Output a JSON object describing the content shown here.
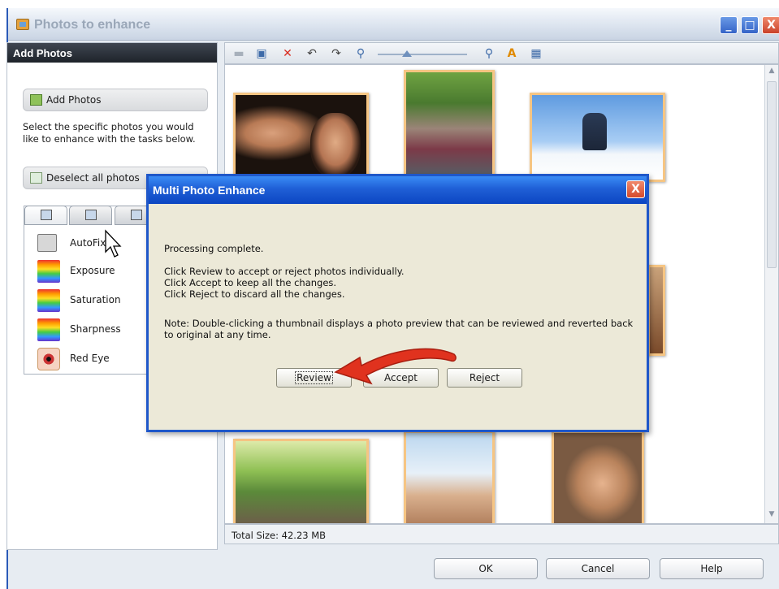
{
  "window": {
    "title": "Photos to enhance",
    "controls": {
      "minimize": "_",
      "maximize": "□",
      "close": "X"
    }
  },
  "left_panel": {
    "header": "Add Photos",
    "add_photos_button": "Add Photos",
    "description": "Select the specific photos you would like to enhance with the tasks below.",
    "deselect_button": "Deselect all photos",
    "tasks": [
      {
        "label": "AutoFix",
        "icon": "autofix-icon"
      },
      {
        "label": "Exposure",
        "icon": "exposure-icon"
      },
      {
        "label": "Saturation",
        "icon": "saturation-icon"
      },
      {
        "label": "Sharpness",
        "icon": "sharpness-icon"
      },
      {
        "label": "Red Eye",
        "icon": "red-eye-icon"
      }
    ]
  },
  "toolbar": {
    "icons": [
      "view-icon",
      "remove-photo-icon",
      "delete-icon",
      "rotate-left-icon",
      "rotate-right-icon",
      "zoom-out-icon",
      "zoom-in-icon",
      "sort-icon",
      "grid-view-icon"
    ]
  },
  "status": {
    "total_size": "Total Size: 42.23 MB"
  },
  "bottom_buttons": {
    "ok": "OK",
    "cancel": "Cancel",
    "help": "Help"
  },
  "dialog": {
    "title": "Multi Photo Enhance",
    "close": "X",
    "message": "Processing complete.",
    "line1": "Click Review to accept or reject photos individually.",
    "line2": "Click Accept to keep all the changes.",
    "line3": "Click Reject to discard all the changes.",
    "note": "Note: Double-clicking a thumbnail displays a photo preview that can be reviewed and reverted back to original at any time.",
    "buttons": {
      "review": "Review",
      "accept": "Accept",
      "reject": "Reject"
    }
  },
  "colors": {
    "title_blue": "#1f57c9",
    "photo_border": "#f6c583",
    "arrow_red": "#e0321e"
  }
}
